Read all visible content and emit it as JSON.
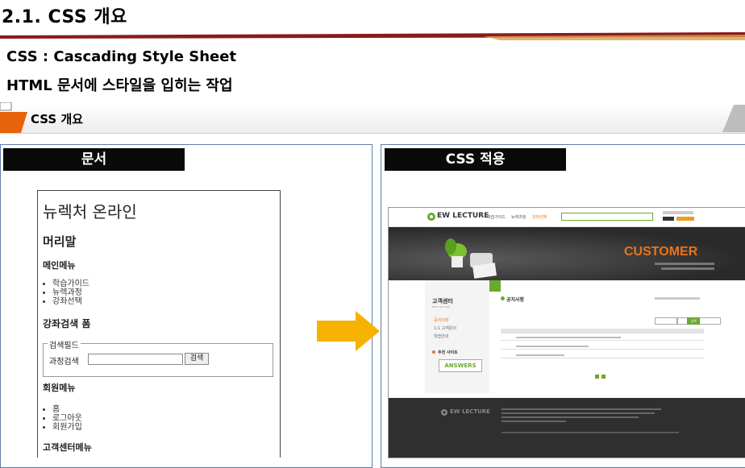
{
  "slide": {
    "title": "2.1. CSS 개요",
    "bullets": [
      "CSS : Cascading Style Sheet",
      "HTML 문서에 스타일을 입히는 작업"
    ],
    "section_title": "CSS 개요"
  },
  "left_panel": {
    "label": "문서",
    "document": {
      "site_title": "뉴렉처 온라인",
      "header": "머리말",
      "main_menu_heading": "메인메뉴",
      "main_menu_items": [
        "학습가이드",
        "뉴렉과정",
        "강좌선택"
      ],
      "search_heading": "강좌검색 폼",
      "fieldset_legend": "검색필드",
      "search_label": "과정검색",
      "search_button": "검색",
      "member_menu_heading": "회원메뉴",
      "member_menu_items": [
        "홈",
        "로그아웃",
        "회원가입"
      ],
      "customer_menu_heading": "고객센터메뉴"
    }
  },
  "right_panel": {
    "label": "CSS 적용",
    "site": {
      "logo_text": "EW LECTURE",
      "nav_items": [
        "학습가이드",
        "뉴렉과정",
        "강좌선택"
      ],
      "hero_title": "CUSTOMER",
      "sidebar_title": "고객센터",
      "sidebar_subtitle": "NEW LECTURE",
      "sidebar_items": [
        "공지사항",
        "1:1 고객문의",
        "학습안내"
      ],
      "recommend_label": "추천 사이트",
      "answers_logo": "ANSWERS",
      "content_title": "공지사항",
      "search_button": "검색",
      "footer_logo": "EW LECTURE"
    }
  },
  "colors": {
    "title_rule": "#8b1a1a",
    "accent_orange": "#f0a010",
    "panel_border": "#5b7fa6",
    "site_green": "#6aa82e",
    "site_orange": "#e8741c"
  }
}
